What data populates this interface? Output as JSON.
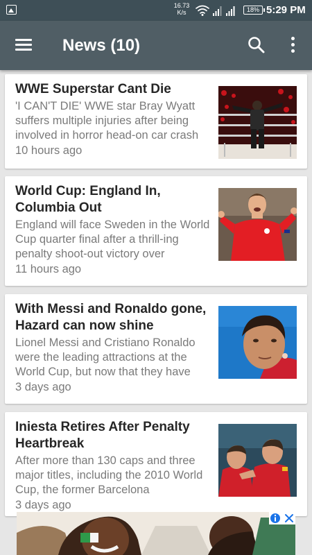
{
  "status_bar": {
    "network_speed_value": "16.73",
    "network_speed_unit": "K/s",
    "battery": "18%",
    "time": "5:29 PM"
  },
  "toolbar": {
    "title": "News (10)",
    "menu_icon": "hamburger-menu-icon",
    "search_icon": "search-icon",
    "more_icon": "more-vert-icon",
    "background_color": "#505e65"
  },
  "articles": [
    {
      "title": "WWE Superstar Cant Die",
      "description": "'I CAN'T DIE'  WWE star Bray Wyatt suffers multiple injuries after being involved in horror head-on car crash",
      "time": "10 hours ago"
    },
    {
      "title": "World Cup: England In, Columbia Out",
      "description": "England will face Sweden in the World Cup quarter final after a thrill-ing penalty shoot-out victory over",
      "time": "11 hours ago"
    },
    {
      "title": "With Messi and Ronaldo gone, Hazard can now shine",
      "description": "Lionel Messi and Cristiano Ronaldo were the leading attractions at the World Cup, but now that they have",
      "time": "3 days ago"
    },
    {
      "title": "Iniesta Retires After Penalty Heartbreak",
      "description": "After more than 130 caps and three major titles, including the 2010 World Cup, the former Barcelona",
      "time": "3 days ago"
    }
  ],
  "ad_banner": {
    "info_icon": "info-icon",
    "close_icon": "close-icon",
    "accent_color": "#1a73e8"
  }
}
